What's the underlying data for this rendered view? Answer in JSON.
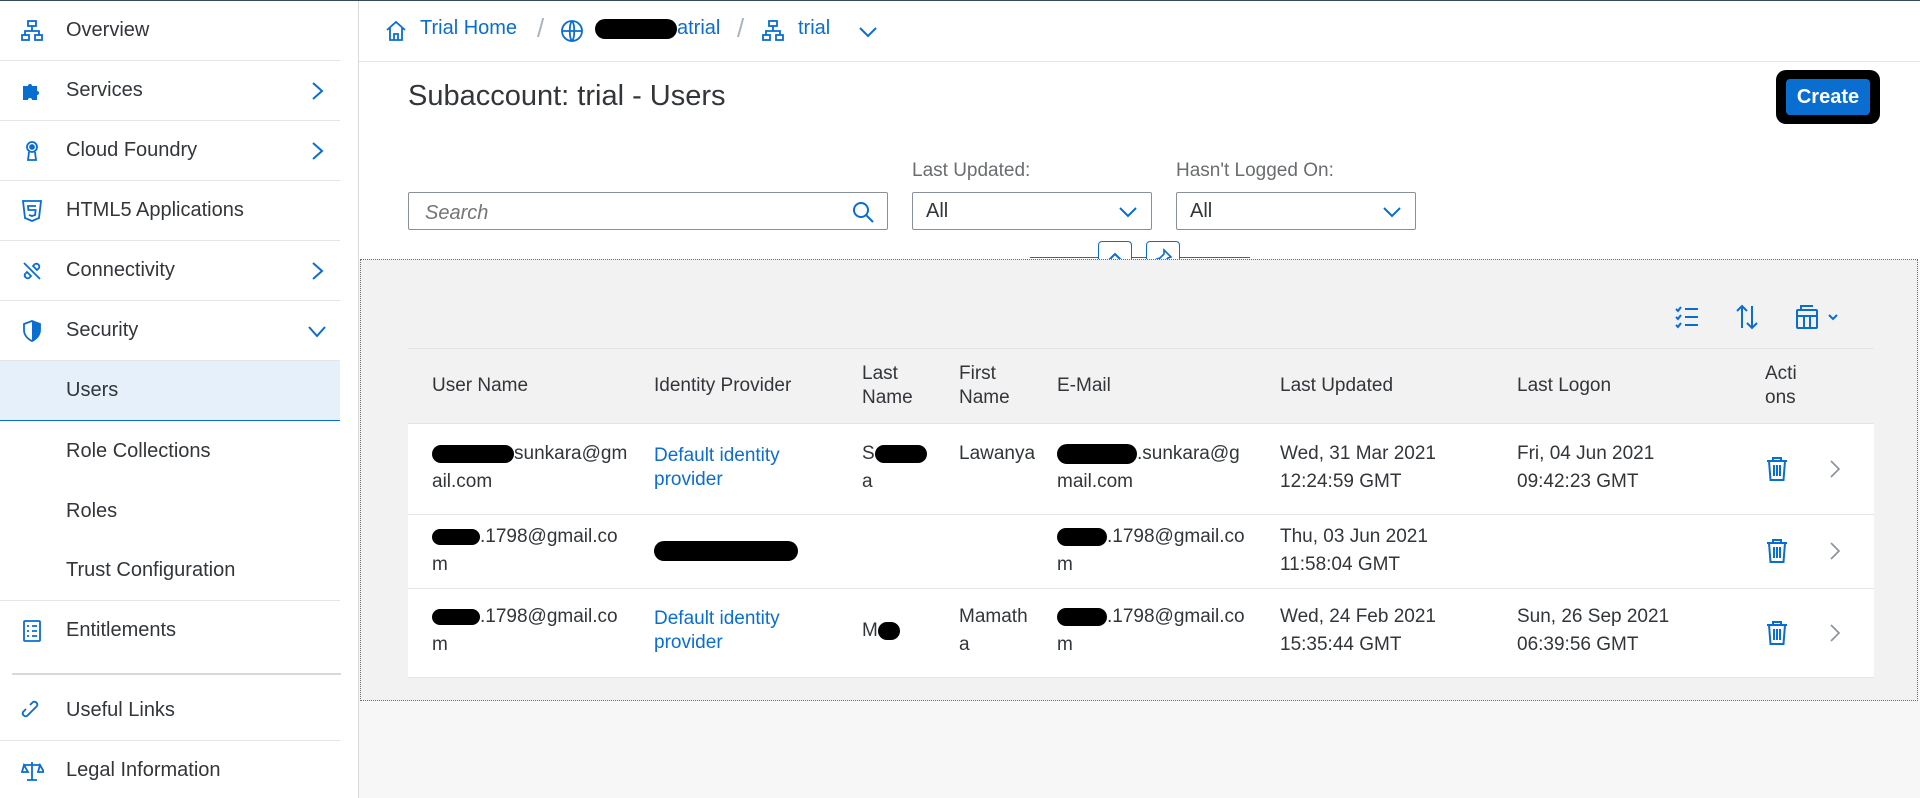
{
  "sidebar": {
    "items": [
      {
        "label": "Overview",
        "icon": "hierarchy-icon"
      },
      {
        "label": "Services",
        "icon": "puzzle-icon"
      },
      {
        "label": "Cloud Foundry",
        "icon": "cloud-foundry-icon"
      },
      {
        "label": "HTML5 Applications",
        "icon": "html5-icon"
      },
      {
        "label": "Connectivity",
        "icon": "connectivity-icon"
      },
      {
        "label": "Security",
        "icon": "shield-icon"
      },
      {
        "label": "Users"
      },
      {
        "label": "Role Collections"
      },
      {
        "label": "Roles"
      },
      {
        "label": "Trust Configuration"
      },
      {
        "label": "Entitlements",
        "icon": "entitlements-icon"
      },
      {
        "label": "Useful Links",
        "icon": "link-icon"
      },
      {
        "label": "Legal Information",
        "icon": "scales-icon"
      }
    ]
  },
  "breadcrumb": {
    "home": "Trial Home",
    "global_suffix": "atrial",
    "subaccount": "trial",
    "separator": "/"
  },
  "page": {
    "title": "Subaccount: trial - Users",
    "create_label": "Create"
  },
  "filters": {
    "search_placeholder": "Search",
    "last_updated_label": "Last Updated:",
    "last_updated_value": "All",
    "not_logged_label": "Hasn't Logged On:",
    "not_logged_value": "All"
  },
  "table": {
    "columns": {
      "user_name": "User Name",
      "identity_provider": "Identity Provider",
      "last_name": "Last Name",
      "first_name": "First Name",
      "email": "E-Mail",
      "last_updated": "Last Updated",
      "last_logon": "Last Logon",
      "actions": "Actions"
    },
    "rows": [
      {
        "user_suffix": "sunkara@gmail.com",
        "idp": "Default identity provider",
        "last_name_first": "S",
        "last_name_end": "a",
        "first_name": "Lawanya",
        "email_suffix": ".sunkara@gmail.com",
        "last_updated": "Wed, 31 Mar 2021 12:24:59 GMT",
        "last_logon": "Fri, 04 Jun 2021 09:42:23 GMT"
      },
      {
        "user_suffix": ".1798@gmail.com",
        "idp": "",
        "last_name_first": "",
        "last_name_end": "",
        "first_name": "",
        "email_suffix": ".1798@gmail.com",
        "last_updated": "Thu, 03 Jun 2021 11:58:04 GMT",
        "last_logon": ""
      },
      {
        "user_suffix": ".1798@gmail.com",
        "idp": "Default identity provider",
        "last_name_first": "M",
        "last_name_end": "",
        "first_name": "Mamatha",
        "email_suffix": ".1798@gmail.com",
        "last_updated": "Wed, 24 Feb 2021 15:35:44 GMT",
        "last_logon": "Sun, 26 Sep 2021 06:39:56 GMT"
      }
    ]
  },
  "colors": {
    "accent": "#0a6ed1",
    "selected_bg": "#e5f0fa",
    "text": "#32363a"
  }
}
